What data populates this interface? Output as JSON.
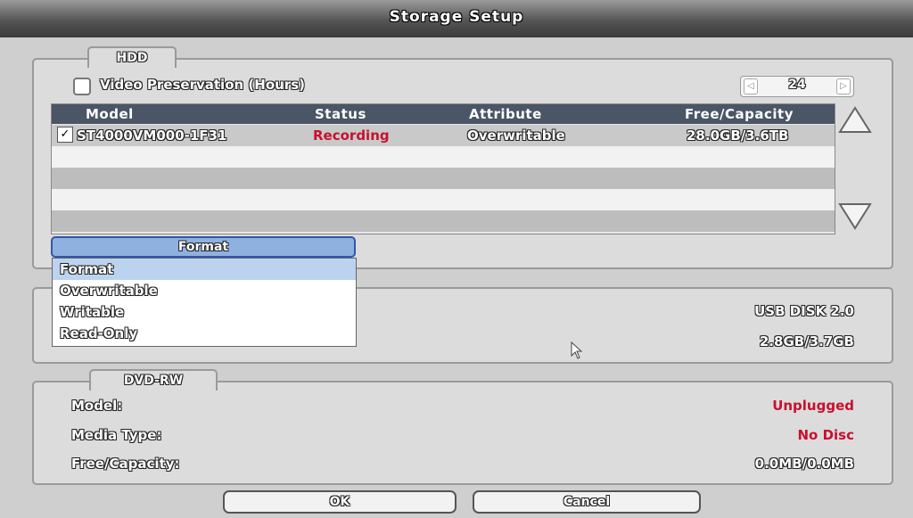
{
  "window": {
    "title": "Storage Setup"
  },
  "hdd": {
    "tab_label": "HDD",
    "video_preservation_label": "Video Preservation (Hours)",
    "video_preservation_checked": false,
    "hours_value": "24",
    "columns": [
      "Model",
      "Status",
      "Attribute",
      "Free/Capacity"
    ],
    "rows": [
      {
        "checked": true,
        "model": "ST4000VM000-1F31",
        "status": "Recording",
        "attribute": "Overwritable",
        "capacity": "28.0GB/3.6TB"
      }
    ],
    "format_button_label": "Format",
    "dropdown_options": [
      "Format",
      "Overwritable",
      "Writable",
      "Read-Only"
    ],
    "dropdown_selected": "Format"
  },
  "usb": {
    "right_values": [
      "USB DISK 2.0",
      "2.8GB/3.7GB"
    ]
  },
  "dvd": {
    "tab_label": "DVD-RW",
    "model_label": "Model:",
    "model_value": "Unplugged",
    "media_type_label": "Media Type:",
    "media_type_value": "No Disc",
    "capacity_label": "Free/Capacity:",
    "capacity_value": "0.0MB/0.0MB"
  },
  "footer": {
    "ok_label": "OK",
    "cancel_label": "Cancel"
  },
  "colors": {
    "status_recording": "#c8102e",
    "table_header": "#4a5566",
    "selected_option": "#bcd3f0"
  }
}
